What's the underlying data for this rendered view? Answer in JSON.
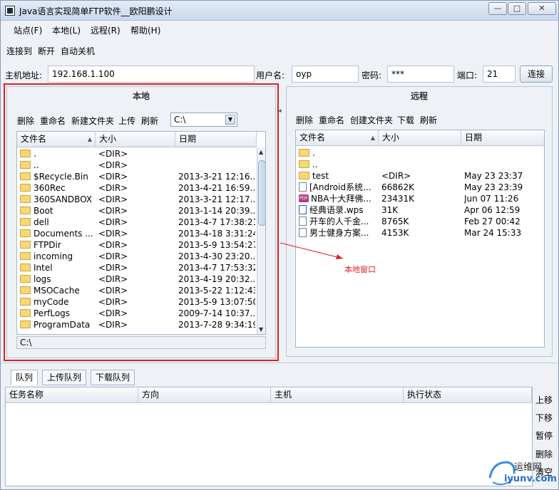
{
  "window": {
    "title": "Java语言实现简单FTP软件__欧阳鹏设计",
    "controls": [
      "—",
      "□",
      "✕"
    ]
  },
  "menu": [
    "站点(F)",
    "本地(L)",
    "远程(R)",
    "帮助(H)"
  ],
  "toolbar": [
    "连接到",
    "断开",
    "自动关机"
  ],
  "connection": {
    "host_label": "主机地址:",
    "host_value": "192.168.1.100",
    "user_label": "用户名:",
    "user_value": "oyp",
    "pass_label": "密码:",
    "pass_value": "***",
    "port_label": "端口:",
    "port_value": "21",
    "connect_label": "连接"
  },
  "local": {
    "title": "本地",
    "tools": [
      "删除",
      "重命名",
      "新建文件夹",
      "上传",
      "刷新"
    ],
    "drive": "C:\\",
    "columns": [
      "文件名",
      "大小",
      "日期"
    ],
    "rows": [
      {
        "name": ".",
        "size": "<DIR>",
        "date": ""
      },
      {
        "name": "..",
        "size": "<DIR>",
        "date": ""
      },
      {
        "name": "$Recycle.Bin",
        "size": "<DIR>",
        "date": "2013-3-21 12:16..."
      },
      {
        "name": "360Rec",
        "size": "<DIR>",
        "date": "2013-4-21 16:59..."
      },
      {
        "name": "360SANDBOX",
        "size": "<DIR>",
        "date": "2013-3-21 12:17..."
      },
      {
        "name": "Boot",
        "size": "<DIR>",
        "date": "2013-1-14 20:39..."
      },
      {
        "name": "dell",
        "size": "<DIR>",
        "date": "2013-4-7 17:38:21"
      },
      {
        "name": "Documents ...",
        "size": "<DIR>",
        "date": "2013-4-18 3:31:24"
      },
      {
        "name": "FTPDir",
        "size": "<DIR>",
        "date": "2013-5-9 13:54:27"
      },
      {
        "name": "incoming",
        "size": "<DIR>",
        "date": "2013-4-30 23:20..."
      },
      {
        "name": "Intel",
        "size": "<DIR>",
        "date": "2013-4-7 17:53:32"
      },
      {
        "name": "logs",
        "size": "<DIR>",
        "date": "2013-4-19 20:32..."
      },
      {
        "name": "MSOCache",
        "size": "<DIR>",
        "date": "2013-5-22 1:12:43"
      },
      {
        "name": "myCode",
        "size": "<DIR>",
        "date": "2013-5-9 13:07:50"
      },
      {
        "name": "PerfLogs",
        "size": "<DIR>",
        "date": "2009-7-14 10:37..."
      },
      {
        "name": "ProgramData",
        "size": "<DIR>",
        "date": "2013-7-28 9:34:19"
      }
    ],
    "path": "C:\\"
  },
  "remote": {
    "title": "远程",
    "tools": [
      "删除",
      "重命名",
      "创建文件夹",
      "下载",
      "刷新"
    ],
    "columns": [
      "文件名",
      "大小",
      "日期"
    ],
    "rows": [
      {
        "icon": "folder",
        "name": ".",
        "size": "",
        "date": ""
      },
      {
        "icon": "folder",
        "name": "..",
        "size": "",
        "date": ""
      },
      {
        "icon": "folder",
        "name": "test",
        "size": "<DIR>",
        "date": "May 23 23:37"
      },
      {
        "icon": "file",
        "name": "[Android系统...",
        "size": "66862K",
        "date": "May 23 23:39"
      },
      {
        "icon": "pdf",
        "name": "NBA十大拜佛...",
        "size": "23431K",
        "date": "Jun 07 11:26"
      },
      {
        "icon": "wps",
        "name": "经典语录.wps",
        "size": "31K",
        "date": "Apr 06 12:59"
      },
      {
        "icon": "file",
        "name": "开车的人千金...",
        "size": "8765K",
        "date": "Feb 27 00:42"
      },
      {
        "icon": "file",
        "name": "男士健身方案...",
        "size": "4153K",
        "date": "Mar 24 15:33"
      }
    ]
  },
  "annotation": {
    "label": "本地窗口",
    "color": "#e02020"
  },
  "queue": {
    "tabs": [
      "队列",
      "上传队列",
      "下载队列"
    ],
    "columns": [
      "任务名称",
      "方向",
      "主机",
      "执行状态"
    ],
    "actions": [
      "上移",
      "下移",
      "暂停",
      "删除",
      "清空"
    ]
  },
  "watermark": {
    "brand": "运维网",
    "site": "iyunv.com"
  }
}
